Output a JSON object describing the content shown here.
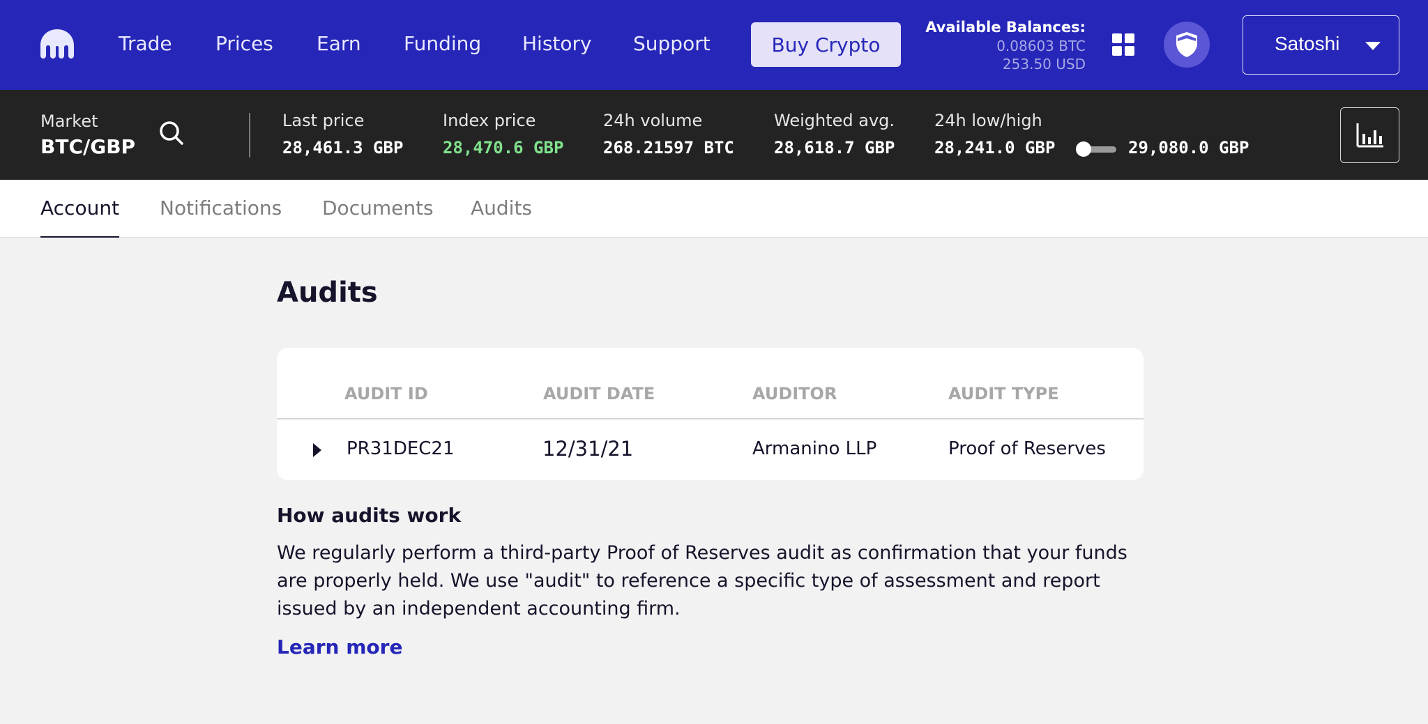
{
  "nav": {
    "links": [
      "Trade",
      "Prices",
      "Earn",
      "Funding",
      "History",
      "Support"
    ],
    "buy_button": "Buy Crypto",
    "balances": {
      "title": "Available Balances:",
      "btc": "0.08603 BTC",
      "usd": "253.50 USD"
    },
    "user_name": "Satoshi",
    "brand_color": "#2626b8"
  },
  "ticker": {
    "market_label": "Market",
    "market_pair": "BTC/GBP",
    "stats": [
      {
        "label": "Last price",
        "value": "28,461.3 GBP"
      },
      {
        "label": "Index price",
        "value": "28,470.6 GBP"
      },
      {
        "label": "24h volume",
        "value": "268.21597 BTC"
      },
      {
        "label": "Weighted avg.",
        "value": "28,618.7 GBP"
      },
      {
        "label": "24h low/high",
        "low": "28,241.0 GBP",
        "high": "29,080.0 GBP"
      }
    ],
    "index_price_color": "#80e28c"
  },
  "tabs": [
    {
      "label": "Account",
      "active": true
    },
    {
      "label": "Notifications",
      "active": false
    },
    {
      "label": "Documents",
      "active": false
    },
    {
      "label": "Audits",
      "active": false
    }
  ],
  "page": {
    "title": "Audits",
    "table": {
      "headers": [
        "AUDIT ID",
        "AUDIT DATE",
        "AUDITOR",
        "AUDIT TYPE"
      ],
      "rows": [
        {
          "id": "PR31DEC21",
          "date": "12/31/21",
          "auditor": "Armanino LLP",
          "type": "Proof of Reserves"
        }
      ]
    },
    "how_title": "How audits work",
    "how_body": "We regularly perform a third-party Proof of Reserves audit as confirmation that your funds are properly held. We use \"audit\" to reference a specific type of assessment and report issued by an independent accounting firm.",
    "learn_more": "Learn more"
  }
}
